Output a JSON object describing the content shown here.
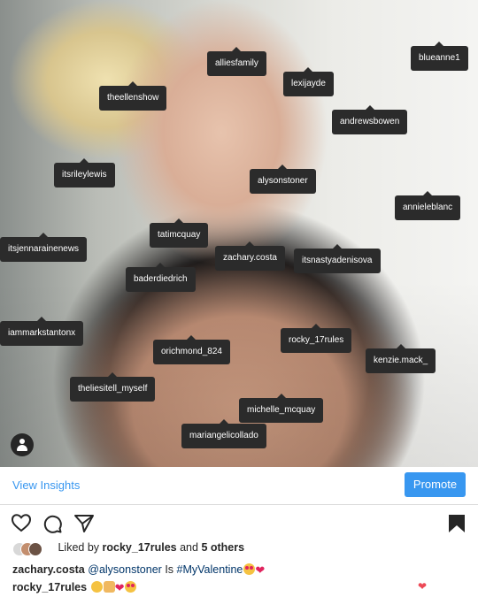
{
  "tags": [
    {
      "id": "blueanne1",
      "label": "blueanne1"
    },
    {
      "id": "alliesfamily",
      "label": "alliesfamily"
    },
    {
      "id": "lexijayde",
      "label": "lexijayde"
    },
    {
      "id": "theellenshow",
      "label": "theellenshow"
    },
    {
      "id": "andrewsbowen",
      "label": "andrewsbowen"
    },
    {
      "id": "itsrileylewis",
      "label": "itsrileylewis"
    },
    {
      "id": "alysonstoner",
      "label": "alysonstoner"
    },
    {
      "id": "annieleblanc",
      "label": "annieleblanc"
    },
    {
      "id": "tatimcquay",
      "label": "tatimcquay"
    },
    {
      "id": "itsjennarainenews",
      "label": "itsjennarainenews"
    },
    {
      "id": "zacharycosta",
      "label": "zachary.costa"
    },
    {
      "id": "itsnastyadenisova",
      "label": "itsnastyadenisova"
    },
    {
      "id": "baderdiedrich",
      "label": "baderdiedrich"
    },
    {
      "id": "iammarkstantonx",
      "label": "iammarkstantonx"
    },
    {
      "id": "rocky17rules",
      "label": "rocky_17rules"
    },
    {
      "id": "orichmond824",
      "label": "orichmond_824"
    },
    {
      "id": "kenziemack",
      "label": "kenzie.mack_"
    },
    {
      "id": "theliesitellmyself",
      "label": "theliesitell_myself"
    },
    {
      "id": "michellemcquay",
      "label": "michelle_mcquay"
    },
    {
      "id": "mariangelicollado",
      "label": "mariangelicollado"
    }
  ],
  "insights": {
    "view_label": "View Insights",
    "promote_label": "Promote"
  },
  "actions": {
    "like_icon": "heart-icon",
    "comment_icon": "comment-icon",
    "share_icon": "share-icon",
    "save_icon": "bookmark-icon"
  },
  "likes": {
    "prefix": "Liked by",
    "user": "rocky_17rules",
    "and": "and",
    "others": "5 others"
  },
  "captions": [
    {
      "user": "zachary.costa",
      "mention": "@alysonstoner",
      "text": "Is",
      "hashtag": "#MyValentine"
    },
    {
      "user": "rocky_17rules"
    }
  ],
  "colors": {
    "accent": "#3897f0",
    "tag_bg": "#2b2b2b",
    "heart": "#ed4956"
  }
}
